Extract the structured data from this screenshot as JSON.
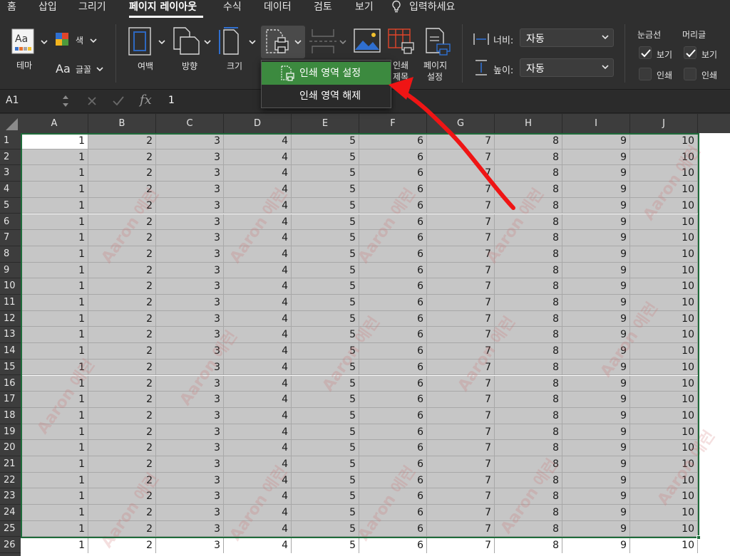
{
  "ribbon_tabs": [
    "홈",
    "삽입",
    "그리기",
    "페이지 레이아웃",
    "수식",
    "데이터",
    "검토",
    "보기",
    "입력하세요"
  ],
  "active_tab": "페이지 레이아웃",
  "ribbon": {
    "theme_label": "테마",
    "color_label": "색",
    "font_label": "글꼴",
    "font_prefix": "Aa",
    "margins_label": "여백",
    "orientation_label": "방향",
    "size_label": "크기",
    "print_titles_label_1": "인쇄",
    "print_titles_label_2": "제목",
    "page_setup_label_1": "페이지",
    "page_setup_label_2": "설정",
    "width_label": "너비:",
    "width_value": "자동",
    "height_label": "높이:",
    "height_value": "자동",
    "gridlines_label": "눈금선",
    "headings_label": "머리글",
    "view_label": "보기",
    "print_label": "인쇄"
  },
  "print_area_menu": {
    "set": "인쇄 영역 설정",
    "clear": "인쇄 영역 해제"
  },
  "formula_bar": {
    "name_box": "A1",
    "fx_symbol": "fx",
    "value": "1"
  },
  "sheet": {
    "columns": [
      "A",
      "B",
      "C",
      "D",
      "E",
      "F",
      "G",
      "H",
      "I",
      "J"
    ],
    "row_values": [
      1,
      2,
      3,
      4,
      5,
      6,
      7,
      8,
      9,
      10
    ],
    "row_count": 26,
    "selected_range_rows": 25
  },
  "watermark_text": "Aaron 에런",
  "colors": {
    "ribbon_bg": "#2f2f2f",
    "menu_highlight": "#3c8a3f",
    "selection_border": "#1e6b3a",
    "selection_fill": "#c6c6c6",
    "arrow": "#ef1515"
  }
}
